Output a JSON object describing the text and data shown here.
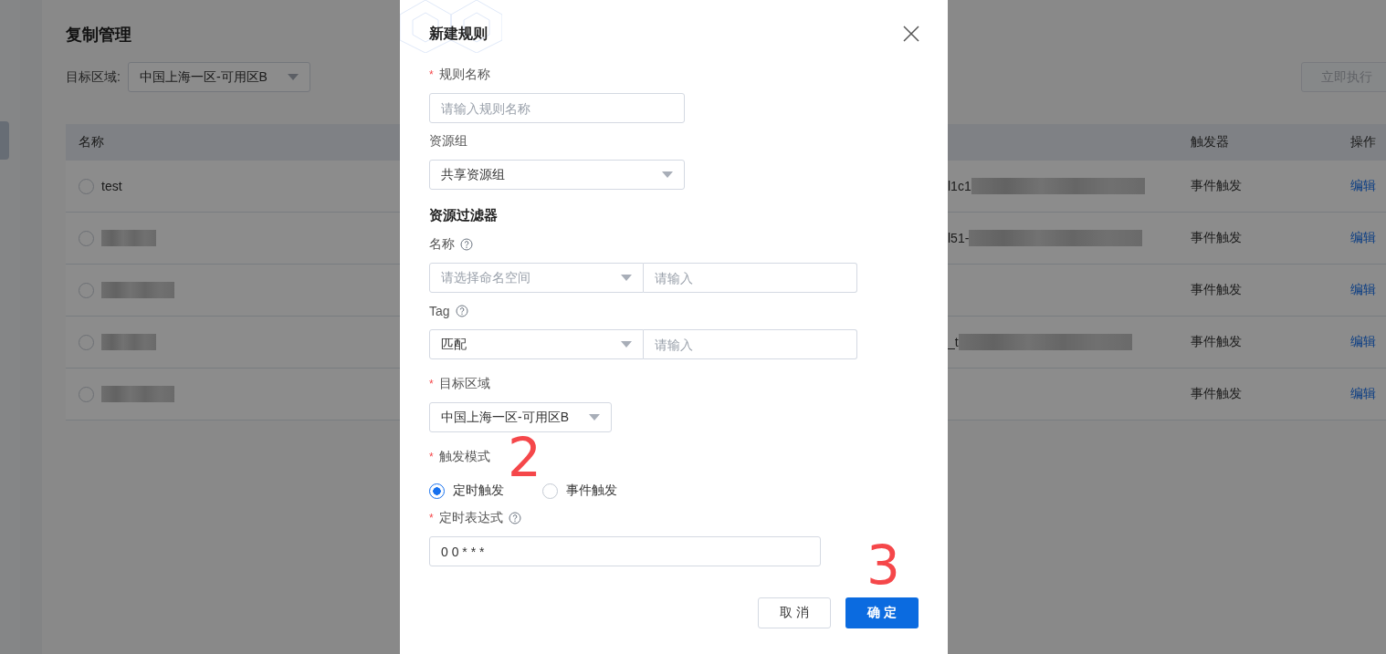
{
  "page": {
    "title": "复制管理",
    "region_label": "目标区域:",
    "region_value": "中国上海一区-可用区B",
    "run_button": "立即执行"
  },
  "table": {
    "columns": [
      {
        "label": "名称"
      },
      {
        "label": "触发器"
      },
      {
        "label": "操作"
      }
    ],
    "rows": [
      {
        "name": "test",
        "selected": false,
        "column_3": "l1c1",
        "trigger": "事件触发",
        "action": "编辑"
      },
      {
        "selected": false,
        "column_3": "l51-",
        "trigger": "事件触发",
        "action": "编辑"
      },
      {
        "selected": false,
        "trigger": "事件触发",
        "action": "编辑"
      },
      {
        "selected": false,
        "column_3": "_t",
        "trigger": "事件触发",
        "action": "编辑"
      },
      {
        "selected": false,
        "trigger": "事件触发",
        "action": "编辑"
      }
    ]
  },
  "dialog": {
    "title": "新建规则",
    "fields": [
      {
        "kind": "input",
        "label": "规则名称",
        "required_mark": "*",
        "placeholder": "请输入规则名称"
      },
      {
        "kind": "select",
        "label": "资源组",
        "value": "共享资源组"
      },
      {
        "kind": "heading",
        "label": "资源过滤器"
      },
      {
        "kind": "pair",
        "label": "名称",
        "help": true,
        "select_placeholder": "请选择命名空间",
        "input_placeholder": "请输入"
      },
      {
        "kind": "pair",
        "label": "Tag",
        "help": true,
        "select_value": "匹配",
        "input_placeholder": "请输入"
      },
      {
        "kind": "short_select",
        "label": "目标区域",
        "required_mark": "*",
        "value": "中国上海一区-可用区B"
      },
      {
        "kind": "radio",
        "label": "触发模式",
        "required_mark": "*",
        "annotation": "2",
        "options": [
          {
            "label": "定时触发",
            "selected": true
          },
          {
            "label": "事件触发",
            "selected": false
          }
        ]
      },
      {
        "kind": "wide_input",
        "label": "定时表达式",
        "required_mark": "*",
        "help": true,
        "value": "0 0 * * *"
      }
    ],
    "buttons": {
      "cancel": "取 消",
      "confirm": "确 定",
      "annotation": "3"
    }
  }
}
